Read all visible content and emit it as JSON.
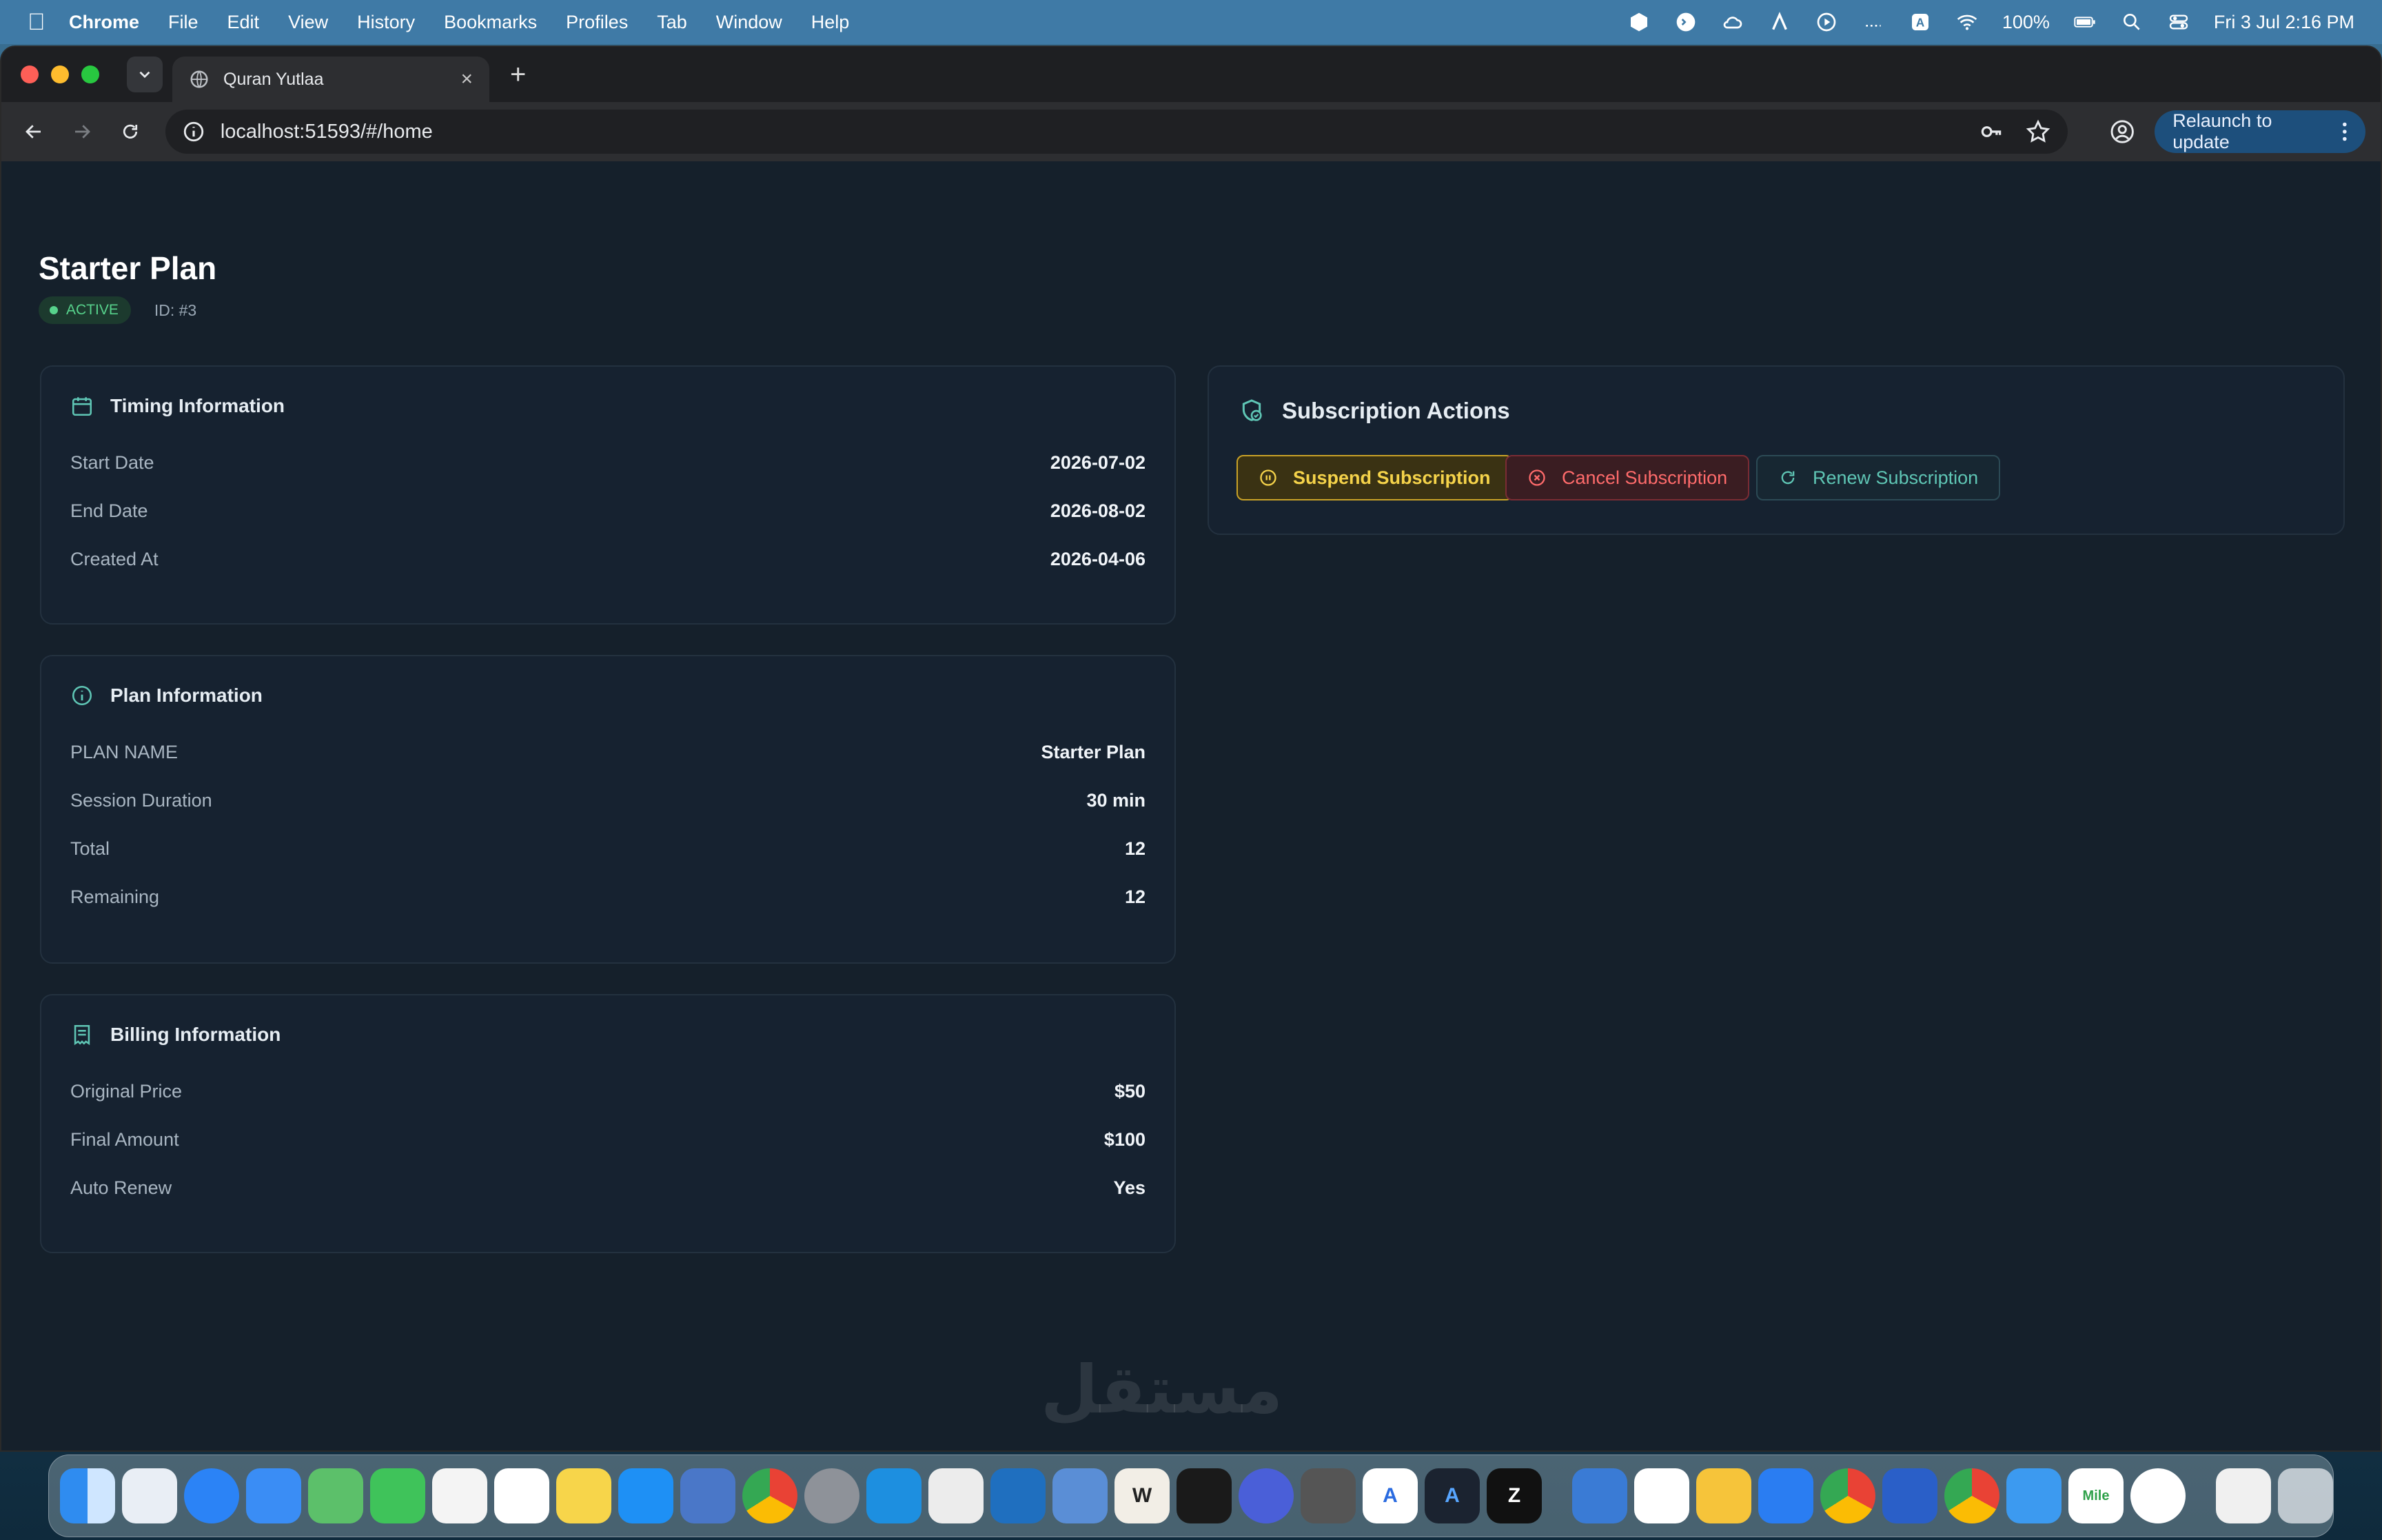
{
  "menubar": {
    "app_name": "Chrome",
    "menus": [
      "File",
      "Edit",
      "View",
      "History",
      "Bookmarks",
      "Profiles",
      "Tab",
      "Window",
      "Help"
    ],
    "battery": "100%",
    "datetime": "Fri 3 Jul  2:16 PM"
  },
  "browser": {
    "tab_title": "Quran Yutlaa",
    "url": "localhost:51593/#/home",
    "relaunch_label": "Relaunch to update"
  },
  "subscription": {
    "title": "Starter Plan",
    "status": "ACTIVE",
    "id_text": "ID: #3"
  },
  "timing": {
    "title": "Timing Information",
    "rows": [
      {
        "label": "Start Date",
        "value": "2026-07-02"
      },
      {
        "label": "End Date",
        "value": "2026-08-02"
      },
      {
        "label": "Created At",
        "value": "2026-04-06"
      }
    ]
  },
  "plan": {
    "title": "Plan Information",
    "rows": [
      {
        "label": "PLAN NAME",
        "value": "Starter Plan"
      },
      {
        "label": "Session Duration",
        "value": "30 min"
      },
      {
        "label": "Total",
        "value": "12"
      },
      {
        "label": "Remaining",
        "value": "12"
      }
    ]
  },
  "billing": {
    "title": "Billing Information",
    "rows": [
      {
        "label": "Original Price",
        "value": "$50"
      },
      {
        "label": "Final Amount",
        "value": "$100"
      },
      {
        "label": "Auto Renew",
        "value": "Yes"
      }
    ]
  },
  "actions": {
    "title": "Subscription Actions",
    "suspend_label": "Suspend Subscription",
    "cancel_label": "Cancel Subscription",
    "renew_label": "Renew Subscription"
  },
  "watermark": "مستقل",
  "colors": {
    "page_bg": "#15202b",
    "card_bg": "#162230",
    "active_green": "#57d38c",
    "suspend_yellow": "#f5d34a",
    "cancel_red": "#ff6b6b",
    "renew_teal": "#5fc6b5"
  },
  "dock": {
    "apps": [
      "finder-icon",
      "launchpad-icon",
      "safari-icon",
      "mail-icon",
      "maps-icon",
      "facetime-icon",
      "photos-icon",
      "reminders-icon",
      "notes-icon",
      "app-store-icon",
      "simulator-icon",
      "chrome-icon",
      "settings-icon",
      "docker-icon",
      "postgres-icon",
      "vscode-icon",
      "files-icon",
      "writer-icon",
      "unity-icon",
      "proxyman-icon",
      "book-icon",
      "arc-icon",
      "affinity-icon",
      "zed-icon",
      "trash-disk-icon",
      "notebook-icon",
      "bulb-icon",
      "quickq-icon",
      "chrome-2-icon",
      "orb-icon",
      "chrome-3-icon",
      "testflight-icon",
      "mile-icon",
      "android-icon",
      "document-icon",
      "trash-icon"
    ]
  }
}
